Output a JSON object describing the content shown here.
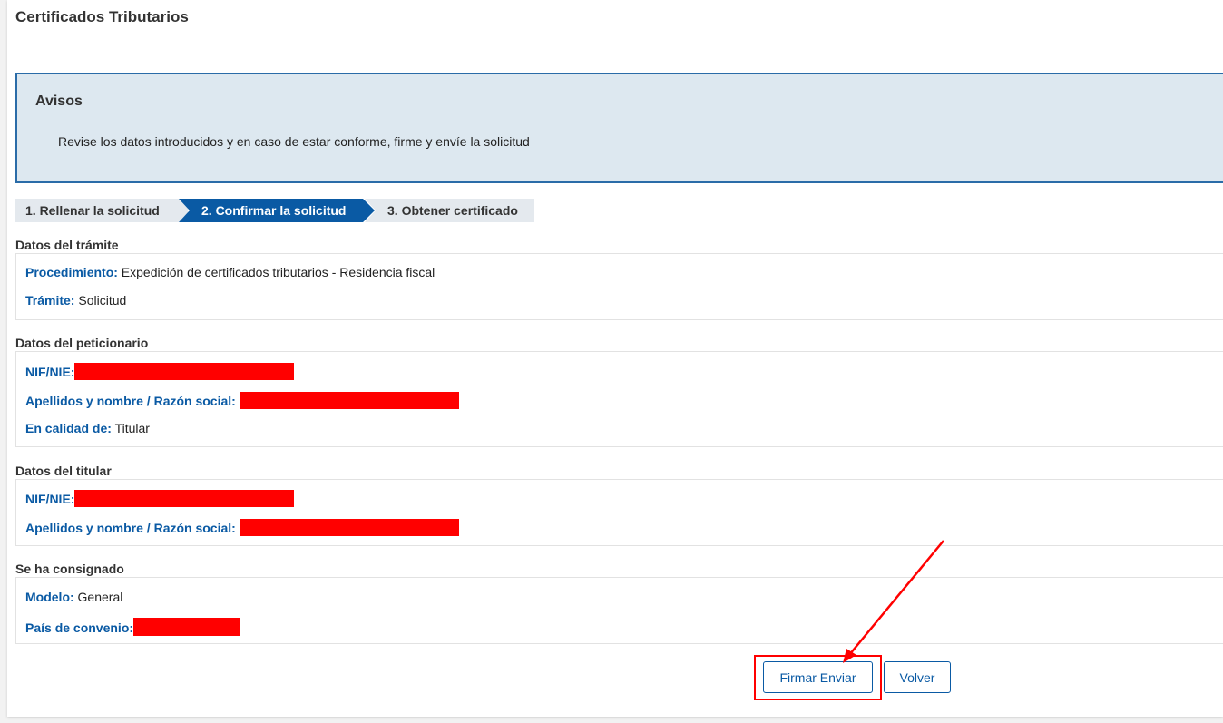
{
  "page": {
    "title": "Certificados Tributarios"
  },
  "alert": {
    "title": "Avisos",
    "text": "Revise los datos introducidos y en caso de estar conforme, firme y envíe la solicitud"
  },
  "steps": [
    {
      "label": "1. Rellenar la solicitud",
      "active": false
    },
    {
      "label": "2. Confirmar la solicitud",
      "active": true
    },
    {
      "label": "3. Obtener certificado",
      "active": false
    }
  ],
  "tramite": {
    "title": "Datos del trámite",
    "procedimiento_label": "Procedimiento:",
    "procedimiento_value": "Expedición de certificados tributarios - Residencia fiscal",
    "tramite_label": "Trámite:",
    "tramite_value": "Solicitud"
  },
  "peticionario": {
    "title": "Datos del peticionario",
    "nif_label": "NIF/NIE:",
    "nombre_label": "Apellidos y nombre / Razón social:",
    "calidad_label": "En calidad de:",
    "calidad_value": "Titular"
  },
  "titular": {
    "title": "Datos del titular",
    "nif_label": "NIF/NIE:",
    "nombre_label": "Apellidos y nombre / Razón social:"
  },
  "consignado": {
    "title": "Se ha consignado",
    "modelo_label": "Modelo:",
    "modelo_value": "General",
    "pais_label": "País de convenio:"
  },
  "buttons": {
    "firmar": "Firmar Enviar",
    "volver": "Volver"
  },
  "colors": {
    "accent": "#0a5aa4",
    "alert_bg": "#dde8f0",
    "redaction": "#ff0000"
  }
}
